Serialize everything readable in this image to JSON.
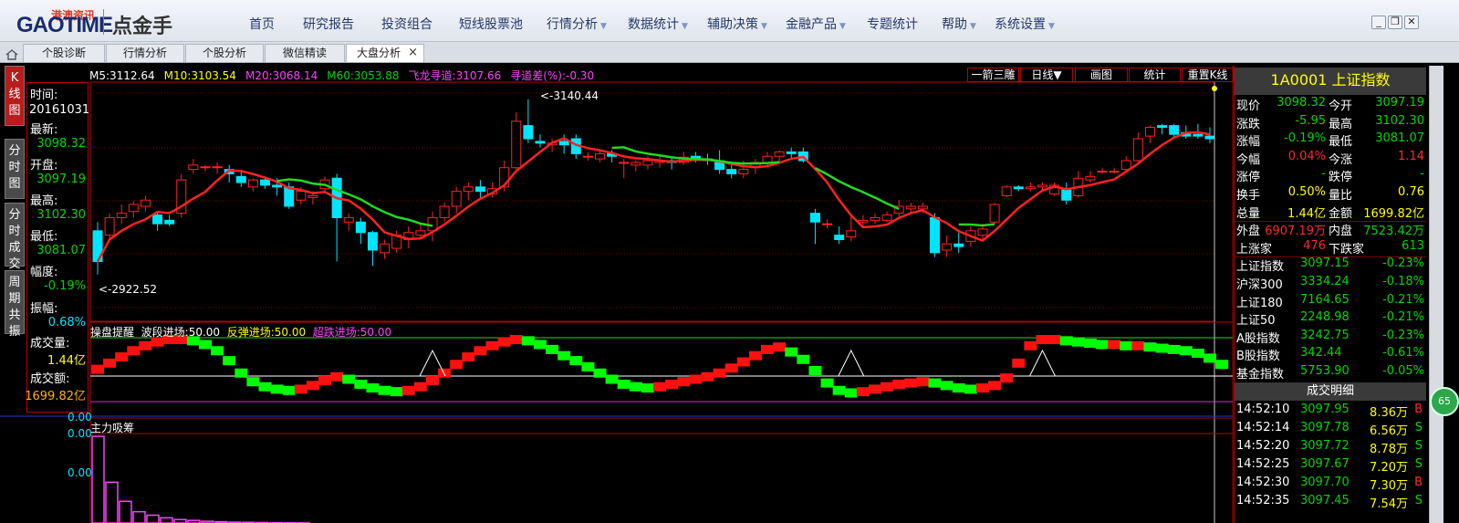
{
  "app": {
    "logo_text": "GAOTIME",
    "logo_cn": "港澳资讯",
    "product": "点金手",
    "menu": [
      {
        "label": "首页",
        "dropdown": false
      },
      {
        "label": "研究报告",
        "dropdown": false
      },
      {
        "label": "投资组合",
        "dropdown": false
      },
      {
        "label": "短线股票池",
        "dropdown": false
      },
      {
        "label": "行情分析",
        "dropdown": true
      },
      {
        "label": "数据统计",
        "dropdown": true
      },
      {
        "label": "辅助决策",
        "dropdown": true
      },
      {
        "label": "金融产品",
        "dropdown": true
      },
      {
        "label": "专题统计",
        "dropdown": false
      },
      {
        "label": "帮助",
        "dropdown": true
      },
      {
        "label": "系统设置",
        "dropdown": true
      }
    ],
    "window": {
      "minimize": "_",
      "restore": "❐",
      "close": "✕"
    }
  },
  "tabs": [
    {
      "label": "个股诊断",
      "active": false
    },
    {
      "label": "行情分析",
      "active": false
    },
    {
      "label": "个股分析",
      "active": false
    },
    {
      "label": "微信精读",
      "active": false
    },
    {
      "label": "大盘分析",
      "active": true,
      "close": "×"
    }
  ],
  "side_tabs": [
    {
      "label": "K线图",
      "active": true
    },
    {
      "label": "分时图",
      "active": false
    },
    {
      "label": "分时成交",
      "active": false
    },
    {
      "label": "周期共振",
      "active": false
    }
  ],
  "info_panel": [
    {
      "label": "时间:",
      "value": "20161031",
      "color": "#ffffff"
    },
    {
      "label": "最新:",
      "value": "3098.32",
      "color": "#00d800"
    },
    {
      "label": "开盘:",
      "value": "3097.19",
      "color": "#00d800"
    },
    {
      "label": "最高:",
      "value": "3102.30",
      "color": "#00d800"
    },
    {
      "label": "最低:",
      "value": "3081.07",
      "color": "#00d800"
    },
    {
      "label": "幅度:",
      "value": "-0.19%",
      "color": "#00d800"
    },
    {
      "label": "振幅:",
      "value": "0.68%",
      "color": "#00e5ff"
    },
    {
      "label": "成交量:",
      "value": "1.44亿",
      "color": "#ffff00"
    },
    {
      "label": "成交额:",
      "value": "1699.82亿",
      "color": "#ffb000"
    }
  ],
  "ma_legend": [
    {
      "text": "M5:3112.64",
      "color": "#ffffff"
    },
    {
      "text": "M10:3103.54",
      "color": "#ffff00"
    },
    {
      "text": "M20:3068.14",
      "color": "#ff40ff"
    },
    {
      "text": "M60:3053.88",
      "color": "#00d800"
    },
    {
      "text": "飞龙寻道:3107.66",
      "color": "#ff40ff"
    },
    {
      "text": "寻道差(%):-0.30",
      "color": "#ff40ff"
    }
  ],
  "chart_buttons": [
    "一箭三雕",
    "日线▼",
    "画图",
    "统计",
    "重置K线"
  ],
  "annotations": {
    "high": "<-3140.44",
    "low": "<-2922.52"
  },
  "indicator1": {
    "title": "操盘提醒",
    "items": [
      {
        "text": "波段进场:50.00",
        "color": "#ffffff"
      },
      {
        "text": "反弹进场:50.00",
        "color": "#ffff00"
      },
      {
        "text": "超跌进场:50.00",
        "color": "#ff40ff"
      }
    ],
    "axis_label": "0.00"
  },
  "indicator2": {
    "title": "主力吸筹",
    "axis_labels": [
      "0.00",
      "0.00"
    ]
  },
  "chart_data": [
    {
      "type": "candlestick",
      "title": "",
      "unit": "index points",
      "candles": [
        [
          2990,
          2955,
          3000,
          2940
        ],
        [
          2985,
          3005,
          3010,
          2980
        ],
        [
          3005,
          3010,
          3020,
          2998
        ],
        [
          3012,
          3020,
          3024,
          3005
        ],
        [
          3018,
          3025,
          3030,
          3012
        ],
        [
          3008,
          2998,
          3012,
          2990
        ],
        [
          3002,
          2998,
          3008,
          2995
        ],
        [
          3010,
          3048,
          3055,
          3005
        ],
        [
          3060,
          3065,
          3072,
          3055
        ],
        [
          3062,
          3063,
          3065,
          3058
        ],
        [
          3062,
          3063,
          3068,
          3055
        ],
        [
          3060,
          3055,
          3065,
          3045
        ],
        [
          3052,
          3045,
          3058,
          3040
        ],
        [
          3040,
          3048,
          3050,
          3035
        ],
        [
          3048,
          3042,
          3052,
          3038
        ],
        [
          3042,
          3040,
          3050,
          3030
        ],
        [
          3040,
          3018,
          3045,
          3015
        ],
        [
          3025,
          3035,
          3040,
          3020
        ],
        [
          3028,
          3030,
          3035,
          3020
        ],
        [
          3038,
          3048,
          3052,
          3035
        ],
        [
          3050,
          3005,
          3055,
          2955
        ],
        [
          3000,
          3005,
          3010,
          2990
        ],
        [
          3000,
          2988,
          3005,
          2975
        ],
        [
          2988,
          2968,
          2990,
          2950
        ],
        [
          2965,
          2975,
          2980,
          2958
        ],
        [
          2970,
          2985,
          2990,
          2965
        ],
        [
          2980,
          2988,
          2995,
          2970
        ],
        [
          2985,
          2990,
          2998,
          2980
        ],
        [
          2990,
          3005,
          3012,
          2978
        ],
        [
          3005,
          3018,
          3022,
          3000
        ],
        [
          3018,
          3035,
          3040,
          3010
        ],
        [
          3035,
          3040,
          3045,
          3025
        ],
        [
          3040,
          3035,
          3048,
          3025
        ],
        [
          3032,
          3038,
          3045,
          3028
        ],
        [
          3040,
          3062,
          3070,
          3035
        ],
        [
          3062,
          3115,
          3125,
          3060
        ],
        [
          3110,
          3095,
          3140,
          3090
        ],
        [
          3092,
          3090,
          3100,
          3085
        ],
        [
          3088,
          3090,
          3095,
          3080
        ],
        [
          3092,
          3088,
          3100,
          3078
        ],
        [
          3095,
          3078,
          3100,
          3072
        ],
        [
          3075,
          3075,
          3080,
          3070
        ],
        [
          3072,
          3078,
          3082,
          3068
        ],
        [
          3078,
          3075,
          3082,
          3068
        ],
        [
          3068,
          3068,
          3072,
          3050
        ],
        [
          3065,
          3068,
          3070,
          3058
        ],
        [
          3065,
          3070,
          3075,
          3060
        ],
        [
          3068,
          3070,
          3076,
          3062
        ],
        [
          3070,
          3068,
          3075,
          3060
        ],
        [
          3068,
          3074,
          3080,
          3065
        ],
        [
          3075,
          3073,
          3080,
          3068
        ],
        [
          3072,
          3070,
          3078,
          3065
        ],
        [
          3070,
          3060,
          3082,
          3055
        ],
        [
          3060,
          3055,
          3065,
          3050
        ],
        [
          3055,
          3060,
          3070,
          3050
        ],
        [
          3062,
          3068,
          3072,
          3055
        ],
        [
          3068,
          3075,
          3080,
          3064
        ],
        [
          3075,
          3080,
          3082,
          3068
        ],
        [
          3080,
          3078,
          3085,
          3072
        ],
        [
          3080,
          3070,
          3085,
          3068
        ],
        [
          3010,
          3000,
          3015,
          2975
        ],
        [
          2998,
          2998,
          3003,
          2993
        ],
        [
          2985,
          2980,
          2995,
          2975
        ],
        [
          2983,
          2990,
          3008,
          2978
        ],
        [
          3000,
          3002,
          3008,
          2995
        ],
        [
          3002,
          3005,
          3010,
          2998
        ],
        [
          3002,
          3008,
          3012,
          3000
        ],
        [
          3010,
          3018,
          3025,
          3005
        ],
        [
          3015,
          3018,
          3022,
          3010
        ],
        [
          3015,
          3018,
          3022,
          3010
        ],
        [
          3005,
          2965,
          3010,
          2960
        ],
        [
          2968,
          2975,
          2985,
          2960
        ],
        [
          2975,
          2972,
          2988,
          2965
        ],
        [
          2978,
          2990,
          2995,
          2972
        ],
        [
          2985,
          2992,
          2998,
          2980
        ],
        [
          3000,
          3020,
          3022,
          2998
        ],
        [
          3030,
          3040,
          3042,
          3028
        ],
        [
          3040,
          3038,
          3042,
          3035
        ],
        [
          3038,
          3040,
          3045,
          3035
        ],
        [
          3040,
          3042,
          3045,
          3035
        ],
        [
          3032,
          3042,
          3045,
          3030
        ],
        [
          3038,
          3025,
          3045,
          3020
        ],
        [
          3030,
          3050,
          3058,
          3028
        ],
        [
          3048,
          3052,
          3058,
          3045
        ],
        [
          3058,
          3058,
          3062,
          3055
        ],
        [
          3058,
          3058,
          3062,
          3055
        ],
        [
          3060,
          3070,
          3075,
          3058
        ],
        [
          3070,
          3095,
          3102,
          3068
        ],
        [
          3098,
          3108,
          3110,
          3090
        ],
        [
          3110,
          3108,
          3112,
          3100
        ],
        [
          3110,
          3100,
          3112,
          3095
        ],
        [
          3102,
          3098,
          3110,
          3095
        ],
        [
          3100,
          3098,
          3112,
          3095
        ],
        [
          3098,
          3095,
          3108,
          3090
        ]
      ],
      "ma_lines": [
        {
          "name": "M5",
          "color": "#ff2222"
        },
        {
          "name": "M20",
          "color": "#22d822"
        }
      ]
    },
    {
      "type": "bar",
      "title": "操盘提醒",
      "values": [
        0.52,
        0.62,
        0.72,
        0.82,
        0.9,
        0.96,
        1.0,
        1.0,
        0.98,
        0.92,
        0.82,
        0.66,
        0.46,
        0.32,
        0.24,
        0.2,
        0.18,
        0.2,
        0.26,
        0.34,
        0.4,
        0.36,
        0.28,
        0.22,
        0.18,
        0.16,
        0.18,
        0.24,
        0.34,
        0.46,
        0.6,
        0.72,
        0.82,
        0.9,
        0.96,
        1.0,
        0.98,
        0.92,
        0.84,
        0.74,
        0.66,
        0.56,
        0.46,
        0.36,
        0.28,
        0.24,
        0.22,
        0.24,
        0.28,
        0.32,
        0.36,
        0.4,
        0.46,
        0.54,
        0.64,
        0.74,
        0.84,
        0.88,
        0.8,
        0.68,
        0.5,
        0.3,
        0.18,
        0.14,
        0.16,
        0.2,
        0.24,
        0.28,
        0.3,
        0.32,
        0.3,
        0.26,
        0.22,
        0.2,
        0.22,
        0.26,
        0.38,
        0.62,
        0.9,
        1.0,
        1.0,
        0.98,
        0.96,
        0.94,
        0.92,
        0.92,
        0.9,
        0.9,
        0.88,
        0.86,
        0.84,
        0.82,
        0.78,
        0.7,
        0.6
      ],
      "signals": [
        28,
        63,
        79
      ]
    },
    {
      "type": "bar",
      "title": "主力吸筹",
      "values": [
        1.0,
        0.47,
        0.25,
        0.13,
        0.09,
        0.06,
        0.04,
        0.03,
        0.02,
        0.015,
        0.01,
        0.008,
        0.006,
        0.004,
        0.003,
        0.002
      ]
    }
  ],
  "quote": {
    "title": "1A0001   上证指数",
    "rows": [
      {
        "l1": "现价",
        "v1": "3098.32",
        "c1": "#00d800",
        "l2": "今开",
        "v2": "3097.19",
        "c2": "#00d800"
      },
      {
        "l1": "涨跌",
        "v1": "-5.95",
        "c1": "#00d800",
        "l2": "最高",
        "v2": "3102.30",
        "c2": "#00d800"
      },
      {
        "l1": "涨幅",
        "v1": "-0.19%",
        "c1": "#00d800",
        "l2": "最低",
        "v2": "3081.07",
        "c2": "#00d800"
      },
      {
        "l1": "今幅",
        "v1": "0.04%",
        "c1": "#ff2a2a",
        "l2": "今涨",
        "v2": "1.14",
        "c2": "#ff2a2a"
      },
      {
        "l1": "涨停",
        "v1": "-",
        "c1": "#00d800",
        "l2": "跌停",
        "v2": "-",
        "c2": "#00d800"
      },
      {
        "l1": "换手",
        "v1": "0.50%",
        "c1": "#ffff00",
        "l2": "量比",
        "v2": "0.76",
        "c2": "#ffff00"
      },
      {
        "l1": "总量",
        "v1": "1.44亿",
        "c1": "#ffff00",
        "l2": "金额",
        "v2": "1699.82亿",
        "c2": "#ffff00"
      },
      {
        "l1": "外盘",
        "v1": "6907.19万",
        "c1": "#ff2a2a",
        "l2": "内盘",
        "v2": "7523.42万",
        "c2": "#00d800"
      },
      {
        "l1": "上涨家",
        "v1": "476",
        "c1": "#ff2a2a",
        "l2": "下跌家",
        "v2": "613",
        "c2": "#00d800"
      }
    ],
    "indices": [
      {
        "name": "上证指数",
        "value": "3097.15",
        "change": "-0.23%"
      },
      {
        "name": "沪深300",
        "value": "3334.24",
        "change": "-0.18%"
      },
      {
        "name": "上证180",
        "value": "7164.65",
        "change": "-0.21%"
      },
      {
        "name": "上证50",
        "value": "2248.98",
        "change": "-0.21%"
      },
      {
        "name": "A股指数",
        "value": "3242.75",
        "change": "-0.23%"
      },
      {
        "name": "B股指数",
        "value": "342.44",
        "change": "-0.61%"
      },
      {
        "name": "基金指数",
        "value": "5753.90",
        "change": "-0.05%"
      }
    ],
    "trades_title": "成交明细",
    "trades": [
      {
        "time": "14:52:10",
        "price": "3097.95",
        "vol": "8.36万",
        "side": "B",
        "color": "#ff2a2a"
      },
      {
        "time": "14:52:14",
        "price": "3097.78",
        "vol": "6.56万",
        "side": "S",
        "color": "#00d800"
      },
      {
        "time": "14:52:20",
        "price": "3097.72",
        "vol": "8.78万",
        "side": "S",
        "color": "#00d800"
      },
      {
        "time": "14:52:25",
        "price": "3097.67",
        "vol": "7.20万",
        "side": "S",
        "color": "#00d800"
      },
      {
        "time": "14:52:30",
        "price": "3097.70",
        "vol": "7.30万",
        "side": "B",
        "color": "#ff2a2a"
      },
      {
        "time": "14:52:35",
        "price": "3097.45",
        "vol": "7.54万",
        "side": "S",
        "color": "#00d800"
      }
    ],
    "badge": "65"
  },
  "colors": {
    "up": "#ff2222",
    "down": "#00e5ff",
    "border": "#b00000",
    "bg": "#000000"
  }
}
